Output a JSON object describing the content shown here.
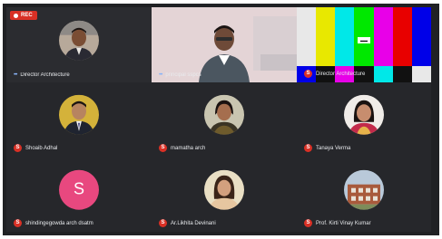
{
  "recording": {
    "label": "REC"
  },
  "colors": {
    "accent_red": "#d93025",
    "avatar_pink": "#e8487f",
    "background": "#202124"
  },
  "participants": [
    {
      "name": "Director Architecture",
      "indicator": "speaking-dots-icon"
    },
    {
      "name": "principal sspcs",
      "indicator": "speaking-dots-icon"
    },
    {
      "name": "Director Architecture",
      "indicator": "muted-mic-icon"
    },
    {
      "name": "Shoaib Adhal",
      "indicator": "muted-mic-icon"
    },
    {
      "name": "mamatha arch",
      "indicator": "muted-mic-icon"
    },
    {
      "name": "Tanaya Verma",
      "indicator": "muted-mic-icon"
    },
    {
      "name": "shindingegowda arch dsatm",
      "indicator": "muted-mic-icon",
      "avatar_letter": "S"
    },
    {
      "name": "Ar.Likhita Devinani",
      "indicator": "muted-mic-icon"
    },
    {
      "name": "Prof. Kirti Vinay Kumar",
      "indicator": "muted-mic-icon"
    }
  ],
  "icons": {
    "muted_glyph": "S"
  }
}
